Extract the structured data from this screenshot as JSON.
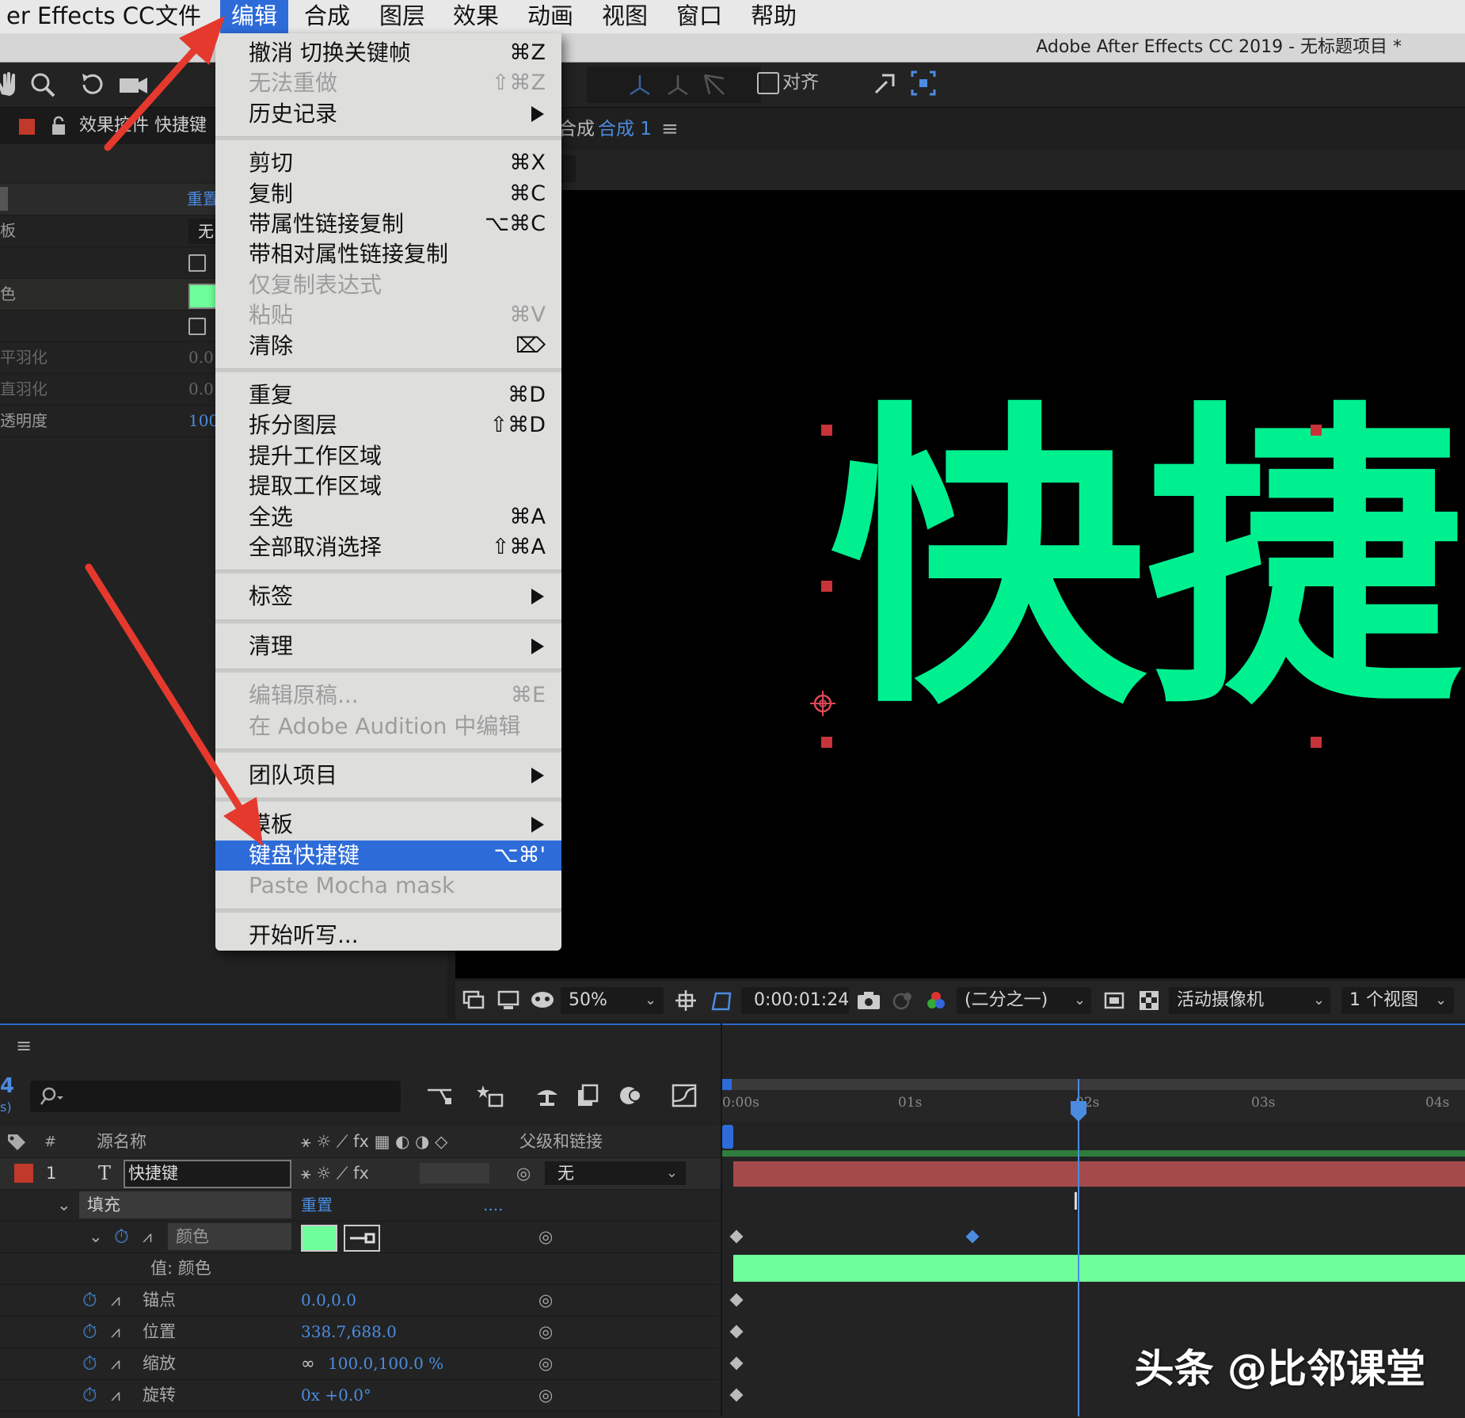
{
  "menubar": {
    "items": [
      {
        "label": "er Effects CC"
      },
      {
        "label": "文件"
      },
      {
        "label": "编辑"
      },
      {
        "label": "合成"
      },
      {
        "label": "图层"
      },
      {
        "label": "效果"
      },
      {
        "label": "动画"
      },
      {
        "label": "视图"
      },
      {
        "label": "窗口"
      },
      {
        "label": "帮助"
      }
    ]
  },
  "window": {
    "title": "Adobe After Effects CC 2019 - 无标题项目 *"
  },
  "toolbar": {
    "align_label": "对齐"
  },
  "effect_panel": {
    "tab_label": "效果控件 快捷键",
    "reset_label": "重置",
    "rows": [
      {
        "label": "板",
        "value": "无"
      },
      {
        "label": "色"
      },
      {
        "label": "平羽化",
        "value": "0.0"
      },
      {
        "label": "直羽化",
        "value": "0.0"
      },
      {
        "label": "透明度",
        "value": "100."
      }
    ]
  },
  "comp_panel": {
    "tab_prefix": "合成",
    "tab_name": "合成 1"
  },
  "viewer": {
    "text": "快捷",
    "text_color": "#00f090",
    "zoom": "50%",
    "timecode": "0:00:01:24",
    "resolution": "(二分之一)",
    "camera": "活动摄像机",
    "views": "1 个视图"
  },
  "edit_menu": {
    "groups": [
      [
        {
          "label": "撤消 切换关键帧",
          "shortcut": "⌘Z"
        },
        {
          "label": "无法重做",
          "shortcut": "⇧⌘Z",
          "disabled": true
        },
        {
          "label": "历史记录",
          "submenu": true
        }
      ],
      [
        {
          "label": "剪切",
          "shortcut": "⌘X"
        },
        {
          "label": "复制",
          "shortcut": "⌘C"
        },
        {
          "label": "带属性链接复制",
          "shortcut": "⌥⌘C"
        },
        {
          "label": "带相对属性链接复制"
        },
        {
          "label": "仅复制表达式",
          "disabled": true
        },
        {
          "label": "粘贴",
          "shortcut": "⌘V",
          "disabled": true
        },
        {
          "label": "清除",
          "shortcut": "⌦"
        }
      ],
      [
        {
          "label": "重复",
          "shortcut": "⌘D"
        },
        {
          "label": "拆分图层",
          "shortcut": "⇧⌘D"
        },
        {
          "label": "提升工作区域"
        },
        {
          "label": "提取工作区域"
        },
        {
          "label": "全选",
          "shortcut": "⌘A"
        },
        {
          "label": "全部取消选择",
          "shortcut": "⇧⌘A"
        }
      ],
      [
        {
          "label": "标签",
          "submenu": true
        }
      ],
      [
        {
          "label": "清理",
          "submenu": true
        }
      ],
      [
        {
          "label": "编辑原稿...",
          "shortcut": "⌘E",
          "disabled": true
        },
        {
          "label": "在 Adobe Audition 中编辑",
          "disabled": true
        }
      ],
      [
        {
          "label": "团队项目",
          "submenu": true
        }
      ],
      [
        {
          "label": "模板",
          "submenu": true
        },
        {
          "label": "键盘快捷键",
          "shortcut": "⌥⌘'",
          "highlighted": true
        },
        {
          "label": "Paste Mocha mask",
          "disabled": true
        }
      ],
      [
        {
          "label": "开始听写..."
        }
      ]
    ]
  },
  "timeline": {
    "frame_label": "4",
    "fps_label": "s)",
    "header": {
      "source_name": "源名称",
      "hash": "#",
      "parent": "父级和链接"
    },
    "ruler": [
      "0:00s",
      "01s",
      "02s",
      "03s",
      "04s"
    ],
    "layer": {
      "index": "1",
      "type": "T",
      "name": "快捷键",
      "parent": "无"
    },
    "properties": {
      "fill_group": "填充",
      "fill_reset": "重置",
      "fill_dots": "....",
      "color_label": "颜色",
      "color_value_label": "值: 颜色",
      "anchor_label": "锚点",
      "anchor_value": "0.0,0.0",
      "position_label": "位置",
      "position_value": "338.7,688.0",
      "scale_label": "缩放",
      "scale_value": "100.0,100.0 %",
      "rotation_label": "旋转",
      "rotation_value": "0x +0.0°"
    },
    "layer_color": "#c0392b",
    "fill_color": "#6fff9a"
  },
  "watermark": "头条 @比邻课堂"
}
